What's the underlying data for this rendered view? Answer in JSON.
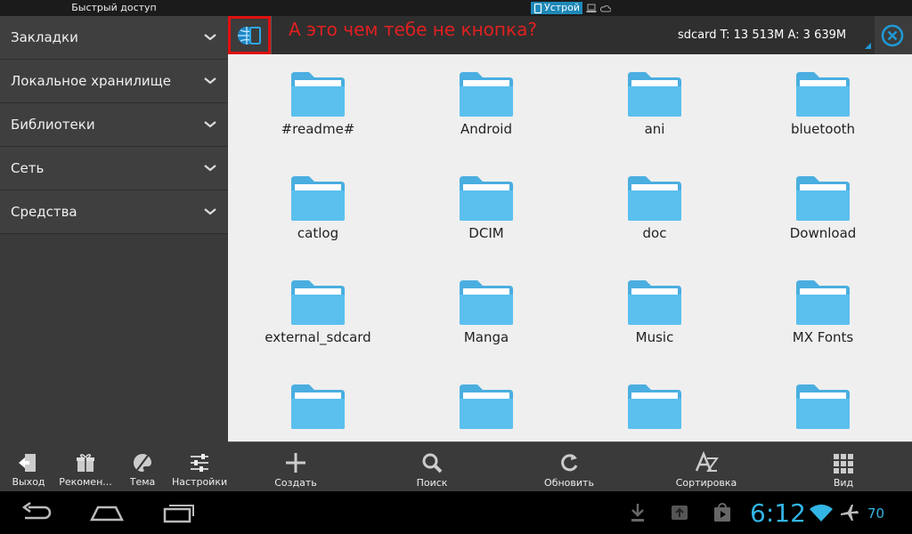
{
  "topbar": {
    "quick_access_title": "Быстрый доступ",
    "active_tab": "Устрой"
  },
  "sidebar": {
    "items": [
      {
        "label": "Закладки"
      },
      {
        "label": "Локальное хранилище"
      },
      {
        "label": "Библиотеки"
      },
      {
        "label": "Сеть"
      },
      {
        "label": "Средства"
      }
    ],
    "bottom": [
      {
        "label": "Выход",
        "icon": "exit-icon"
      },
      {
        "label": "Рекомен...",
        "icon": "gift-icon"
      },
      {
        "label": "Тема",
        "icon": "palette-icon"
      },
      {
        "label": "Настройки",
        "icon": "sliders-icon"
      }
    ]
  },
  "header": {
    "annotation": "А это чем тебе не кнопка?",
    "path": "sdcard  T: 13 513M A: 3 639M"
  },
  "files": [
    {
      "name": "#readme#"
    },
    {
      "name": "Android"
    },
    {
      "name": "ani"
    },
    {
      "name": "bluetooth"
    },
    {
      "name": "catlog"
    },
    {
      "name": "DCIM"
    },
    {
      "name": "doc"
    },
    {
      "name": "Download"
    },
    {
      "name": "external_sdcard"
    },
    {
      "name": "Manga"
    },
    {
      "name": "Music"
    },
    {
      "name": "MX Fonts"
    },
    {
      "name": ""
    },
    {
      "name": ""
    },
    {
      "name": ""
    },
    {
      "name": ""
    }
  ],
  "toolbar": {
    "create": "Создать",
    "search": "Поиск",
    "refresh": "Обновить",
    "sort": "Сортировка",
    "view": "Вид"
  },
  "statusbar": {
    "time": "6:12",
    "battery": "70"
  },
  "colors": {
    "accent": "#33b5e5",
    "folder": "#5bc0ee",
    "annotation": "#e01010"
  }
}
